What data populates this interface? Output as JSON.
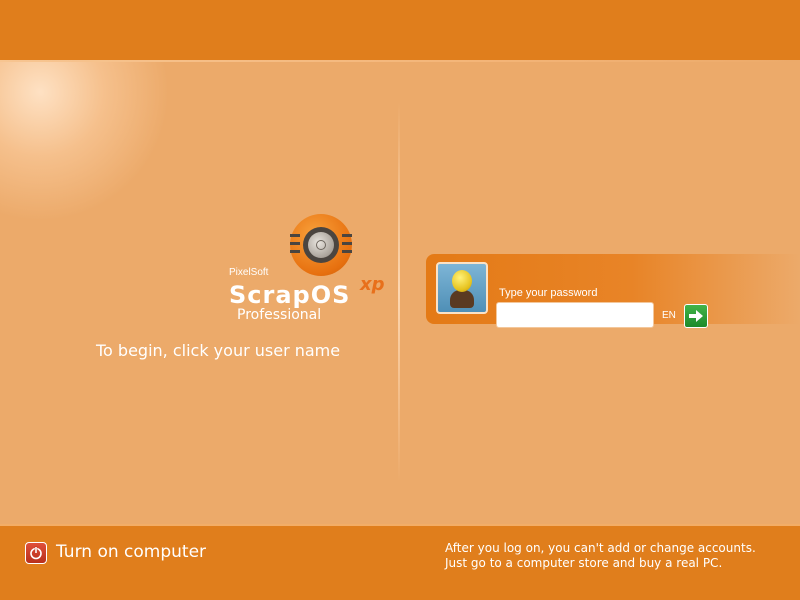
{
  "logo": {
    "brand": "PixelSoft",
    "name": "ScrapOS",
    "version": "xp",
    "edition": "Professional"
  },
  "welcome": {
    "instruction": "To begin, click your user name"
  },
  "user_tile": {
    "password_label": "Type your password",
    "password_value": "",
    "language": "EN",
    "go_icon": "arrow-right-icon"
  },
  "footer": {
    "turn_on_label": "Turn on computer",
    "power_icon": "power-icon",
    "note_line1": "After you log on, you can't add or change accounts.",
    "note_line2": "Just go to a computer store and buy a real PC."
  },
  "colors": {
    "bar": "#e07e1c",
    "background": "#ecaa6a",
    "tile": "#e47a16",
    "go_button": "#2e9a38",
    "power_button": "#d0412c"
  }
}
